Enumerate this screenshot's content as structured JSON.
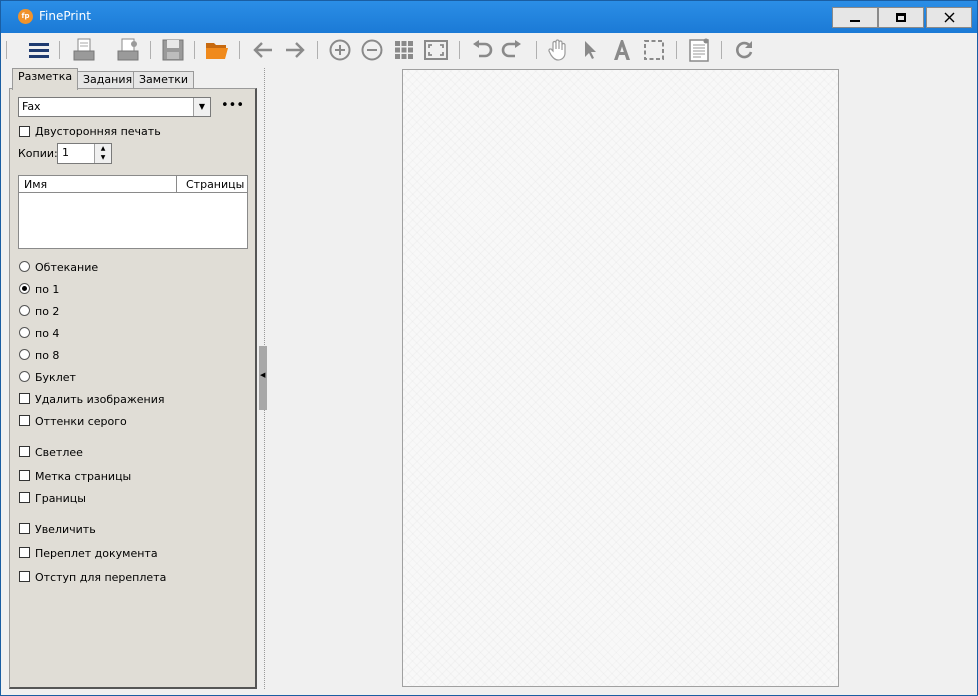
{
  "window": {
    "title": "FinePrint",
    "app_icon_text": "fp"
  },
  "toolbar": {
    "items": [
      "menu-icon",
      "print-icon",
      "print-settings-icon",
      "save-icon",
      "open-folder-icon",
      "back-arrow-icon",
      "forward-arrow-icon",
      "zoom-in-icon",
      "zoom-out-icon",
      "thumbnails-icon",
      "fit-page-icon",
      "undo-icon",
      "redo-icon",
      "hand-icon",
      "pointer-icon",
      "text-icon",
      "select-region-icon",
      "notes-page-icon",
      "refresh-icon"
    ]
  },
  "tabs": [
    {
      "label": "Разметка",
      "active": true
    },
    {
      "label": "Задания",
      "active": false
    },
    {
      "label": "Заметки",
      "active": false
    }
  ],
  "layout_tab": {
    "printer_select": {
      "value": "Fax"
    },
    "more_label": "•••",
    "duplex_label": "Двусторонняя печать",
    "copies_label": "Копии:",
    "copies_value": "1",
    "list_columns": {
      "name": "Имя",
      "pages": "Страницы"
    },
    "radios": [
      {
        "label": "Обтекание",
        "checked": false
      },
      {
        "label": "по 1",
        "checked": true
      },
      {
        "label": "по 2",
        "checked": false
      },
      {
        "label": "по 4",
        "checked": false
      },
      {
        "label": "по 8",
        "checked": false
      },
      {
        "label": "Буклет",
        "checked": false
      }
    ],
    "checks_group1": [
      {
        "label": "Удалить изображения",
        "checked": false
      },
      {
        "label": "Оттенки серого",
        "checked": false
      }
    ],
    "checks_group2": [
      {
        "label": "Светлее",
        "checked": false
      },
      {
        "label": "Метка страницы",
        "checked": false
      },
      {
        "label": "Границы",
        "checked": false
      }
    ],
    "checks_group3": [
      {
        "label": "Увеличить",
        "checked": false
      },
      {
        "label": "Переплет документа",
        "checked": false
      },
      {
        "label": "Отступ для переплета",
        "checked": false
      }
    ]
  },
  "colors": {
    "titlebar": "#1e88e5",
    "panel": "#e0ddd6",
    "folder_accent": "#e8801a"
  }
}
